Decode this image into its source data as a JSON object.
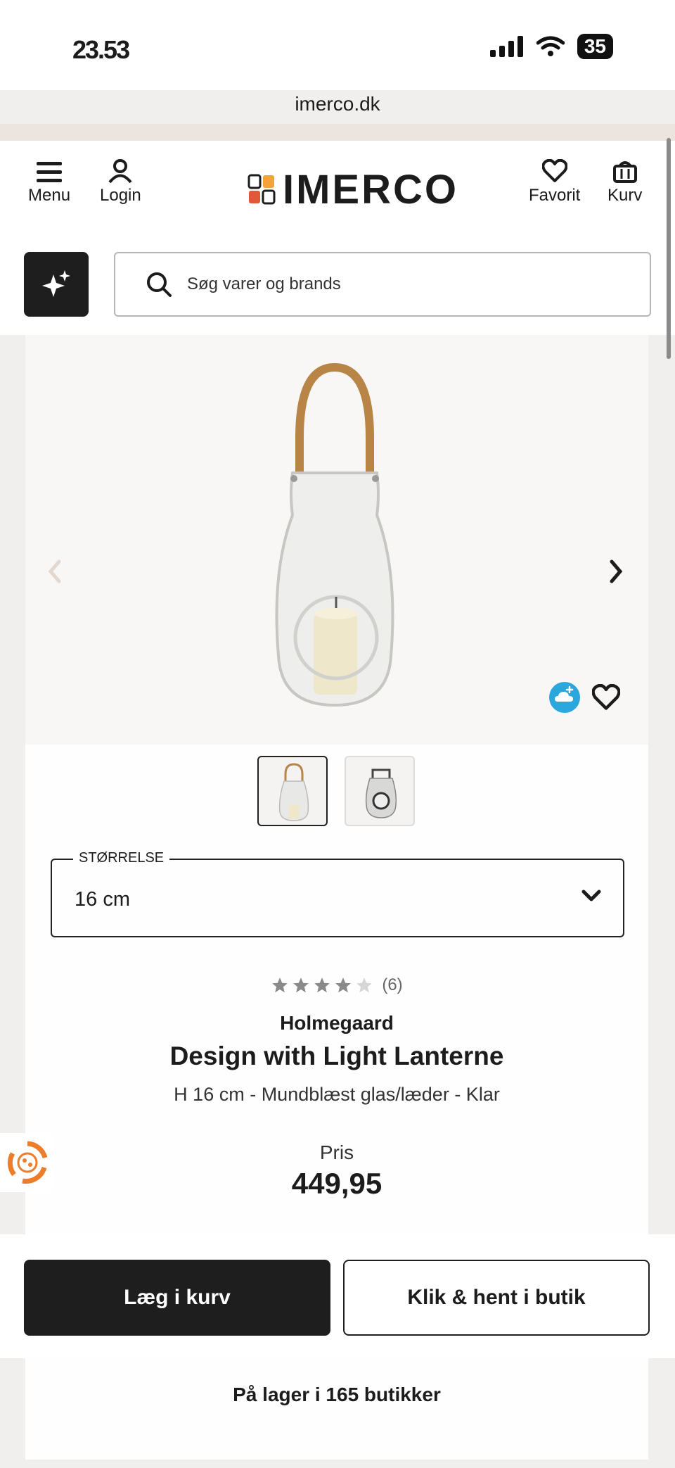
{
  "status_bar": {
    "time": "23.53",
    "battery": "35"
  },
  "browser": {
    "url": "imerco.dk"
  },
  "header": {
    "menu_label": "Menu",
    "login_label": "Login",
    "logo_text": "IMERCO",
    "favorite_label": "Favorit",
    "cart_label": "Kurv"
  },
  "search": {
    "placeholder": "Søg varer og brands"
  },
  "product": {
    "size_label": "STØRRELSE",
    "size_value": "16 cm",
    "rating": 4,
    "rating_max": 5,
    "review_count": "(6)",
    "brand": "Holmegaard",
    "name": "Design with Light Lanterne",
    "description": "H 16 cm - Mundblæst glas/læder - Klar",
    "price_label": "Pris",
    "price": "449,95",
    "stock_text": "På lager i 165 butikker"
  },
  "actions": {
    "add_to_cart": "Læg i kurv",
    "click_collect": "Klik & hent i butik"
  },
  "colors": {
    "dark": "#1e1e1e",
    "accent_orange": "#ee7d2b",
    "cloud_blue": "#2aa7dd"
  }
}
